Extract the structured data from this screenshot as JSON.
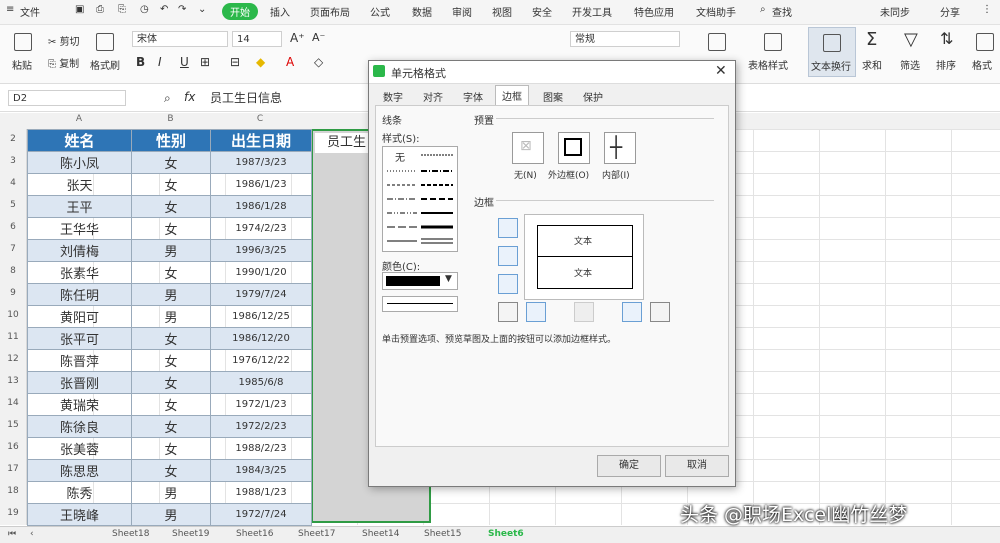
{
  "menu": {
    "file": "文件",
    "tabs": [
      "开始",
      "插入",
      "页面布局",
      "公式",
      "数据",
      "审阅",
      "视图",
      "安全",
      "开发工具",
      "特色应用",
      "文档助手"
    ],
    "search": "查找",
    "unsynced": "未同步",
    "share": "分享"
  },
  "ribbon": {
    "cut": "剪切",
    "copy": "复制",
    "format_painter": "格式刷",
    "paste": "粘贴",
    "font_name": "宋体",
    "font_size": "14",
    "format_select": "常规",
    "wrap_text": "文本换行",
    "sum": "求和",
    "filter": "筛选",
    "sort": "排序",
    "format": "格式",
    "table_style": "表格样式"
  },
  "formula_bar": {
    "cell_ref": "D2",
    "value": "员工生日信息"
  },
  "columns": [
    "A",
    "B",
    "C"
  ],
  "table": {
    "headers": [
      "姓名",
      "性别",
      "出生日期"
    ],
    "rows": [
      [
        "陈小凤",
        "女",
        "1987/3/23"
      ],
      [
        "张天",
        "女",
        "1986/1/23"
      ],
      [
        "王平",
        "女",
        "1986/1/28"
      ],
      [
        "王华华",
        "女",
        "1974/2/23"
      ],
      [
        "刘倩梅",
        "男",
        "1996/3/25"
      ],
      [
        "张素华",
        "女",
        "1990/1/20"
      ],
      [
        "陈任明",
        "男",
        "1979/7/24"
      ],
      [
        "黄阳可",
        "男",
        "1986/12/25"
      ],
      [
        "张平可",
        "女",
        "1986/12/20"
      ],
      [
        "陈晋萍",
        "女",
        "1976/12/22"
      ],
      [
        "张晋刚",
        "女",
        "1985/6/8"
      ],
      [
        "黄瑞荣",
        "女",
        "1972/1/23"
      ],
      [
        "陈徐良",
        "女",
        "1972/2/23"
      ],
      [
        "张美蓉",
        "女",
        "1988/2/23"
      ],
      [
        "陈思思",
        "女",
        "1984/3/25"
      ],
      [
        "陈秀",
        "男",
        "1988/1/23"
      ],
      [
        "王晓峰",
        "男",
        "1972/7/24"
      ]
    ],
    "row_numbers": [
      "2",
      "3",
      "4",
      "5",
      "6",
      "7",
      "8",
      "9",
      "10",
      "11",
      "12",
      "13",
      "14",
      "15",
      "16",
      "17",
      "18",
      "19"
    ]
  },
  "d_column_text": "员工生",
  "sheet_tabs": [
    "Sheet18",
    "Sheet19",
    "Sheet16",
    "Sheet17",
    "Sheet14",
    "Sheet15",
    "Sheet6"
  ],
  "dialog": {
    "title": "单元格格式",
    "tabs": [
      "数字",
      "对齐",
      "字体",
      "边框",
      "图案",
      "保护"
    ],
    "line_section": "线条",
    "style_label": "样式(S):",
    "none_label": "无",
    "color_label": "颜色(C):",
    "preset_section": "预置",
    "preset_none": "无(N)",
    "preset_outline": "外边框(O)",
    "preset_inside": "内部(I)",
    "border_section": "边框",
    "preview_text": "文本",
    "hint": "单击预置选项、预览草图及上面的按钮可以添加边框样式。",
    "ok": "确定",
    "cancel": "取消"
  },
  "watermark": "头条 @职场Excel幽竹丝梦",
  "colors": {
    "header_bg": "#2e75b6",
    "alt_row": "#dce6f2",
    "active_tab": "#2bb84a"
  }
}
